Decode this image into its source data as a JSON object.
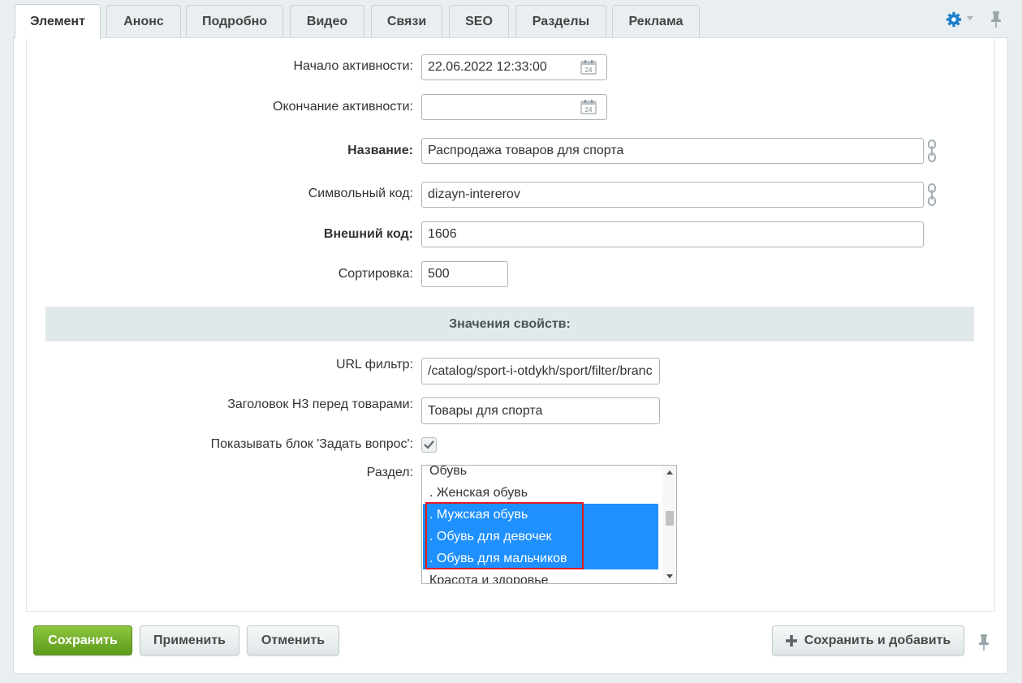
{
  "tabs": [
    "Элемент",
    "Анонс",
    "Подробно",
    "Видео",
    "Связи",
    "SEO",
    "Разделы",
    "Реклама"
  ],
  "icons": {
    "settings": "gear-icon",
    "pin": "pin-icon",
    "calendar": "calendar-icon",
    "calendar_day": "24",
    "translit": "link-icon",
    "add": "plus-icon",
    "accent": "#1e90ff",
    "gear_color": "#1f7fc9",
    "highlight": "#e31b23"
  },
  "form": {
    "active_from": {
      "label": "Начало активности:",
      "value": "22.06.2022 12:33:00"
    },
    "active_to": {
      "label": "Окончание активности:",
      "value": ""
    },
    "name": {
      "label": "Название:",
      "value": "Распродажа товаров для спорта"
    },
    "code": {
      "label": "Символьный код:",
      "value": "dizayn-intererov"
    },
    "xml_id": {
      "label": "Внешний код:",
      "value": "1606"
    },
    "sort": {
      "label": "Сортировка:",
      "value": "500"
    }
  },
  "properties": {
    "header": "Значения свойств:",
    "url_filter": {
      "label": "URL фильтр:",
      "value": "/catalog/sport-i-otdykh/sport/filter/branc"
    },
    "h3_title": {
      "label": "Заголовок Н3 перед товарами:",
      "value": "Товары для спорта"
    },
    "show_question": {
      "label": "Показывать блок 'Задать вопрос':",
      "checked": true
    },
    "section": {
      "label": "Раздел:",
      "options": [
        {
          "text": "Обувь",
          "selected": false
        },
        {
          "text": ". Женская обувь",
          "selected": false
        },
        {
          "text": ". Мужская обувь",
          "selected": true
        },
        {
          "text": ". Обувь для девочек",
          "selected": true
        },
        {
          "text": ". Обувь для мальчиков",
          "selected": true
        },
        {
          "text": "Красота и здоровье",
          "selected": false
        }
      ]
    }
  },
  "buttons": {
    "save": "Сохранить",
    "apply": "Применить",
    "cancel": "Отменить",
    "save_and_add": "Сохранить и добавить"
  }
}
